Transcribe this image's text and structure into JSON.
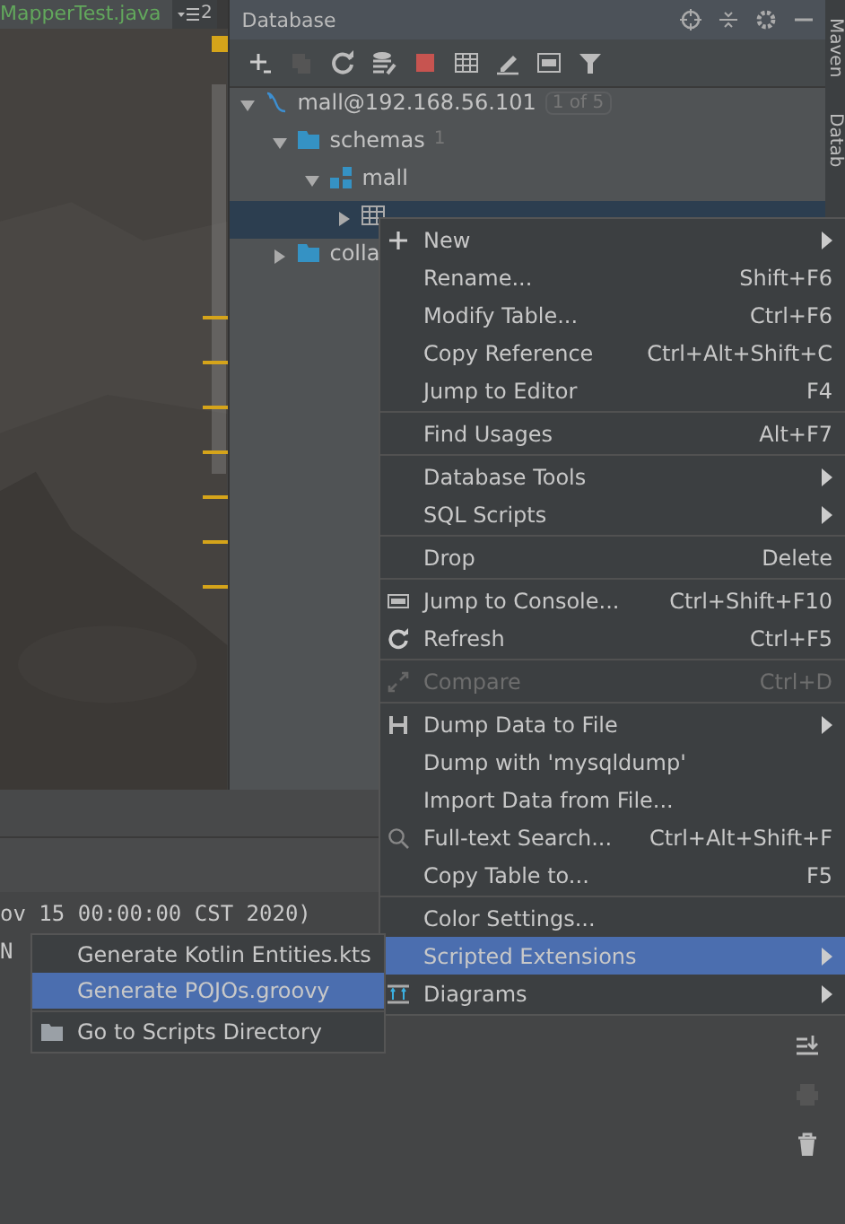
{
  "editor": {
    "tab": "MapperTest.java",
    "tab_count": "2"
  },
  "database": {
    "title": "Database",
    "tree": [
      {
        "label": "mall@192.168.56.101",
        "kind": "datasource",
        "badge": "1 of 5",
        "expanded": true,
        "selected": false,
        "children": [
          {
            "label": "schemas",
            "kind": "folder",
            "count": "1",
            "expanded": true,
            "selected": false,
            "children": [
              {
                "label": "mall",
                "kind": "schema",
                "expanded": true,
                "selected": false,
                "children": [
                  {
                    "kind": "table",
                    "expanded": false,
                    "selected": true
                  }
                ]
              }
            ]
          },
          {
            "label": "colla",
            "kind": "folder",
            "expanded": false,
            "selected": false
          }
        ]
      }
    ]
  },
  "side_tabs": [
    "Maven",
    "Datab"
  ],
  "console": {
    "lines": [
      "ov 15 00:00:00 CST 2020)",
      "N"
    ]
  },
  "context_menu": {
    "sections": [
      [
        {
          "label": "New",
          "kind": "plus",
          "submenu": true,
          "disabled": false,
          "selected": false
        },
        {
          "label": "Rename...",
          "shortcut": "Shift+F6",
          "disabled": false,
          "selected": false
        },
        {
          "label": "Modify Table...",
          "shortcut": "Ctrl+F6",
          "disabled": false,
          "selected": false
        },
        {
          "label": "Copy Reference",
          "shortcut": "Ctrl+Alt+Shift+C",
          "disabled": false,
          "selected": false
        },
        {
          "label": "Jump to Editor",
          "shortcut": "F4",
          "disabled": false,
          "selected": false
        }
      ],
      [
        {
          "label": "Find Usages",
          "shortcut": "Alt+F7",
          "disabled": false,
          "selected": false
        }
      ],
      [
        {
          "label": "Database Tools",
          "submenu": true,
          "disabled": false,
          "selected": false
        },
        {
          "label": "SQL Scripts",
          "submenu": true,
          "disabled": false,
          "selected": false
        }
      ],
      [
        {
          "label": "Drop",
          "shortcut": "Delete",
          "disabled": false,
          "selected": false
        }
      ],
      [
        {
          "label": "Jump to Console...",
          "kind": "console",
          "shortcut": "Ctrl+Shift+F10",
          "disabled": false,
          "selected": false
        },
        {
          "label": "Refresh",
          "kind": "refresh",
          "shortcut": "Ctrl+F5",
          "disabled": false,
          "selected": false
        }
      ],
      [
        {
          "label": "Compare",
          "kind": "compare",
          "shortcut": "Ctrl+D",
          "disabled": true,
          "selected": false
        }
      ],
      [
        {
          "label": "Dump Data to File",
          "kind": "save",
          "submenu": true,
          "disabled": false,
          "selected": false
        },
        {
          "label": "Dump with 'mysqldump'",
          "disabled": false,
          "selected": false
        },
        {
          "label": "Import Data from File...",
          "disabled": false,
          "selected": false
        },
        {
          "label": "Full-text Search...",
          "kind": "search",
          "shortcut": "Ctrl+Alt+Shift+F",
          "disabled": false,
          "selected": false
        },
        {
          "label": "Copy Table to...",
          "shortcut": "F5",
          "disabled": false,
          "selected": false
        }
      ],
      [
        {
          "label": "Color Settings...",
          "disabled": false,
          "selected": false
        },
        {
          "label": "Scripted Extensions",
          "submenu": true,
          "disabled": false,
          "selected": true
        },
        {
          "label": "Diagrams",
          "kind": "diagram",
          "submenu": true,
          "disabled": false,
          "selected": false
        }
      ]
    ]
  },
  "submenu": {
    "sections": [
      [
        {
          "label": "Generate Kotlin Entities.kts",
          "selected": false
        },
        {
          "label": "Generate POJOs.groovy",
          "selected": true
        }
      ],
      [
        {
          "label": "Go to Scripts Directory",
          "kind": "folder",
          "selected": false
        }
      ]
    ]
  }
}
